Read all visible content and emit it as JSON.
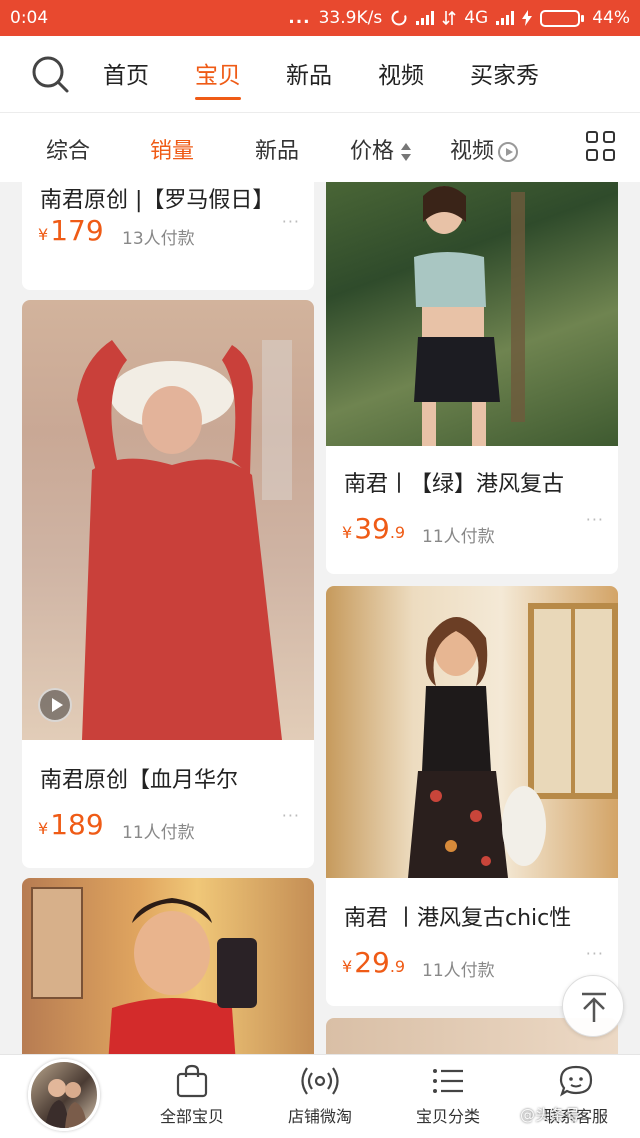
{
  "status_bar": {
    "time": "0:04",
    "dots": "...",
    "speed": "33.9K/s",
    "network": "4G",
    "battery": "44%",
    "battery_level": 0.44
  },
  "top_nav": {
    "tabs": [
      {
        "label": "首页",
        "active": false
      },
      {
        "label": "宝贝",
        "active": true
      },
      {
        "label": "新品",
        "active": false
      },
      {
        "label": "视频",
        "active": false
      },
      {
        "label": "买家秀",
        "active": false
      }
    ]
  },
  "sort_bar": {
    "items": [
      {
        "label": "综合",
        "active": false
      },
      {
        "label": "销量",
        "active": true
      },
      {
        "label": "新品",
        "active": false
      },
      {
        "label": "价格",
        "active": false
      },
      {
        "label": "视频",
        "active": false
      }
    ]
  },
  "products": [
    {
      "title": "南君原创 |【罗马假日】",
      "currency": "¥",
      "price_int": "179",
      "price_dec": "",
      "sales": "13人付款",
      "more": "···"
    },
    {
      "title": "南君原创【血月华尔",
      "currency": "¥",
      "price_int": "189",
      "price_dec": "",
      "sales": "11人付款",
      "more": "···",
      "has_video": true
    },
    {
      "title": "",
      "currency": "",
      "price_int": "",
      "price_dec": "",
      "sales": "",
      "more": ""
    },
    {
      "title": "南君丨【绿】港风复古",
      "currency": "¥",
      "price_int": "39",
      "price_dec": ".9",
      "sales": "11人付款",
      "more": "···"
    },
    {
      "title": "南君 丨港风复古chic性",
      "currency": "¥",
      "price_int": "29",
      "price_dec": ".9",
      "sales": "11人付款",
      "more": "···"
    }
  ],
  "bottom_bar": {
    "items": [
      {
        "label": "全部宝贝",
        "icon": "shopping-bag-icon"
      },
      {
        "label": "店铺微淘",
        "icon": "broadcast-icon"
      },
      {
        "label": "宝贝分类",
        "icon": "list-icon"
      },
      {
        "label": "联系客服",
        "icon": "chat-bubble-icon"
      }
    ]
  },
  "watermark": "@头条号"
}
